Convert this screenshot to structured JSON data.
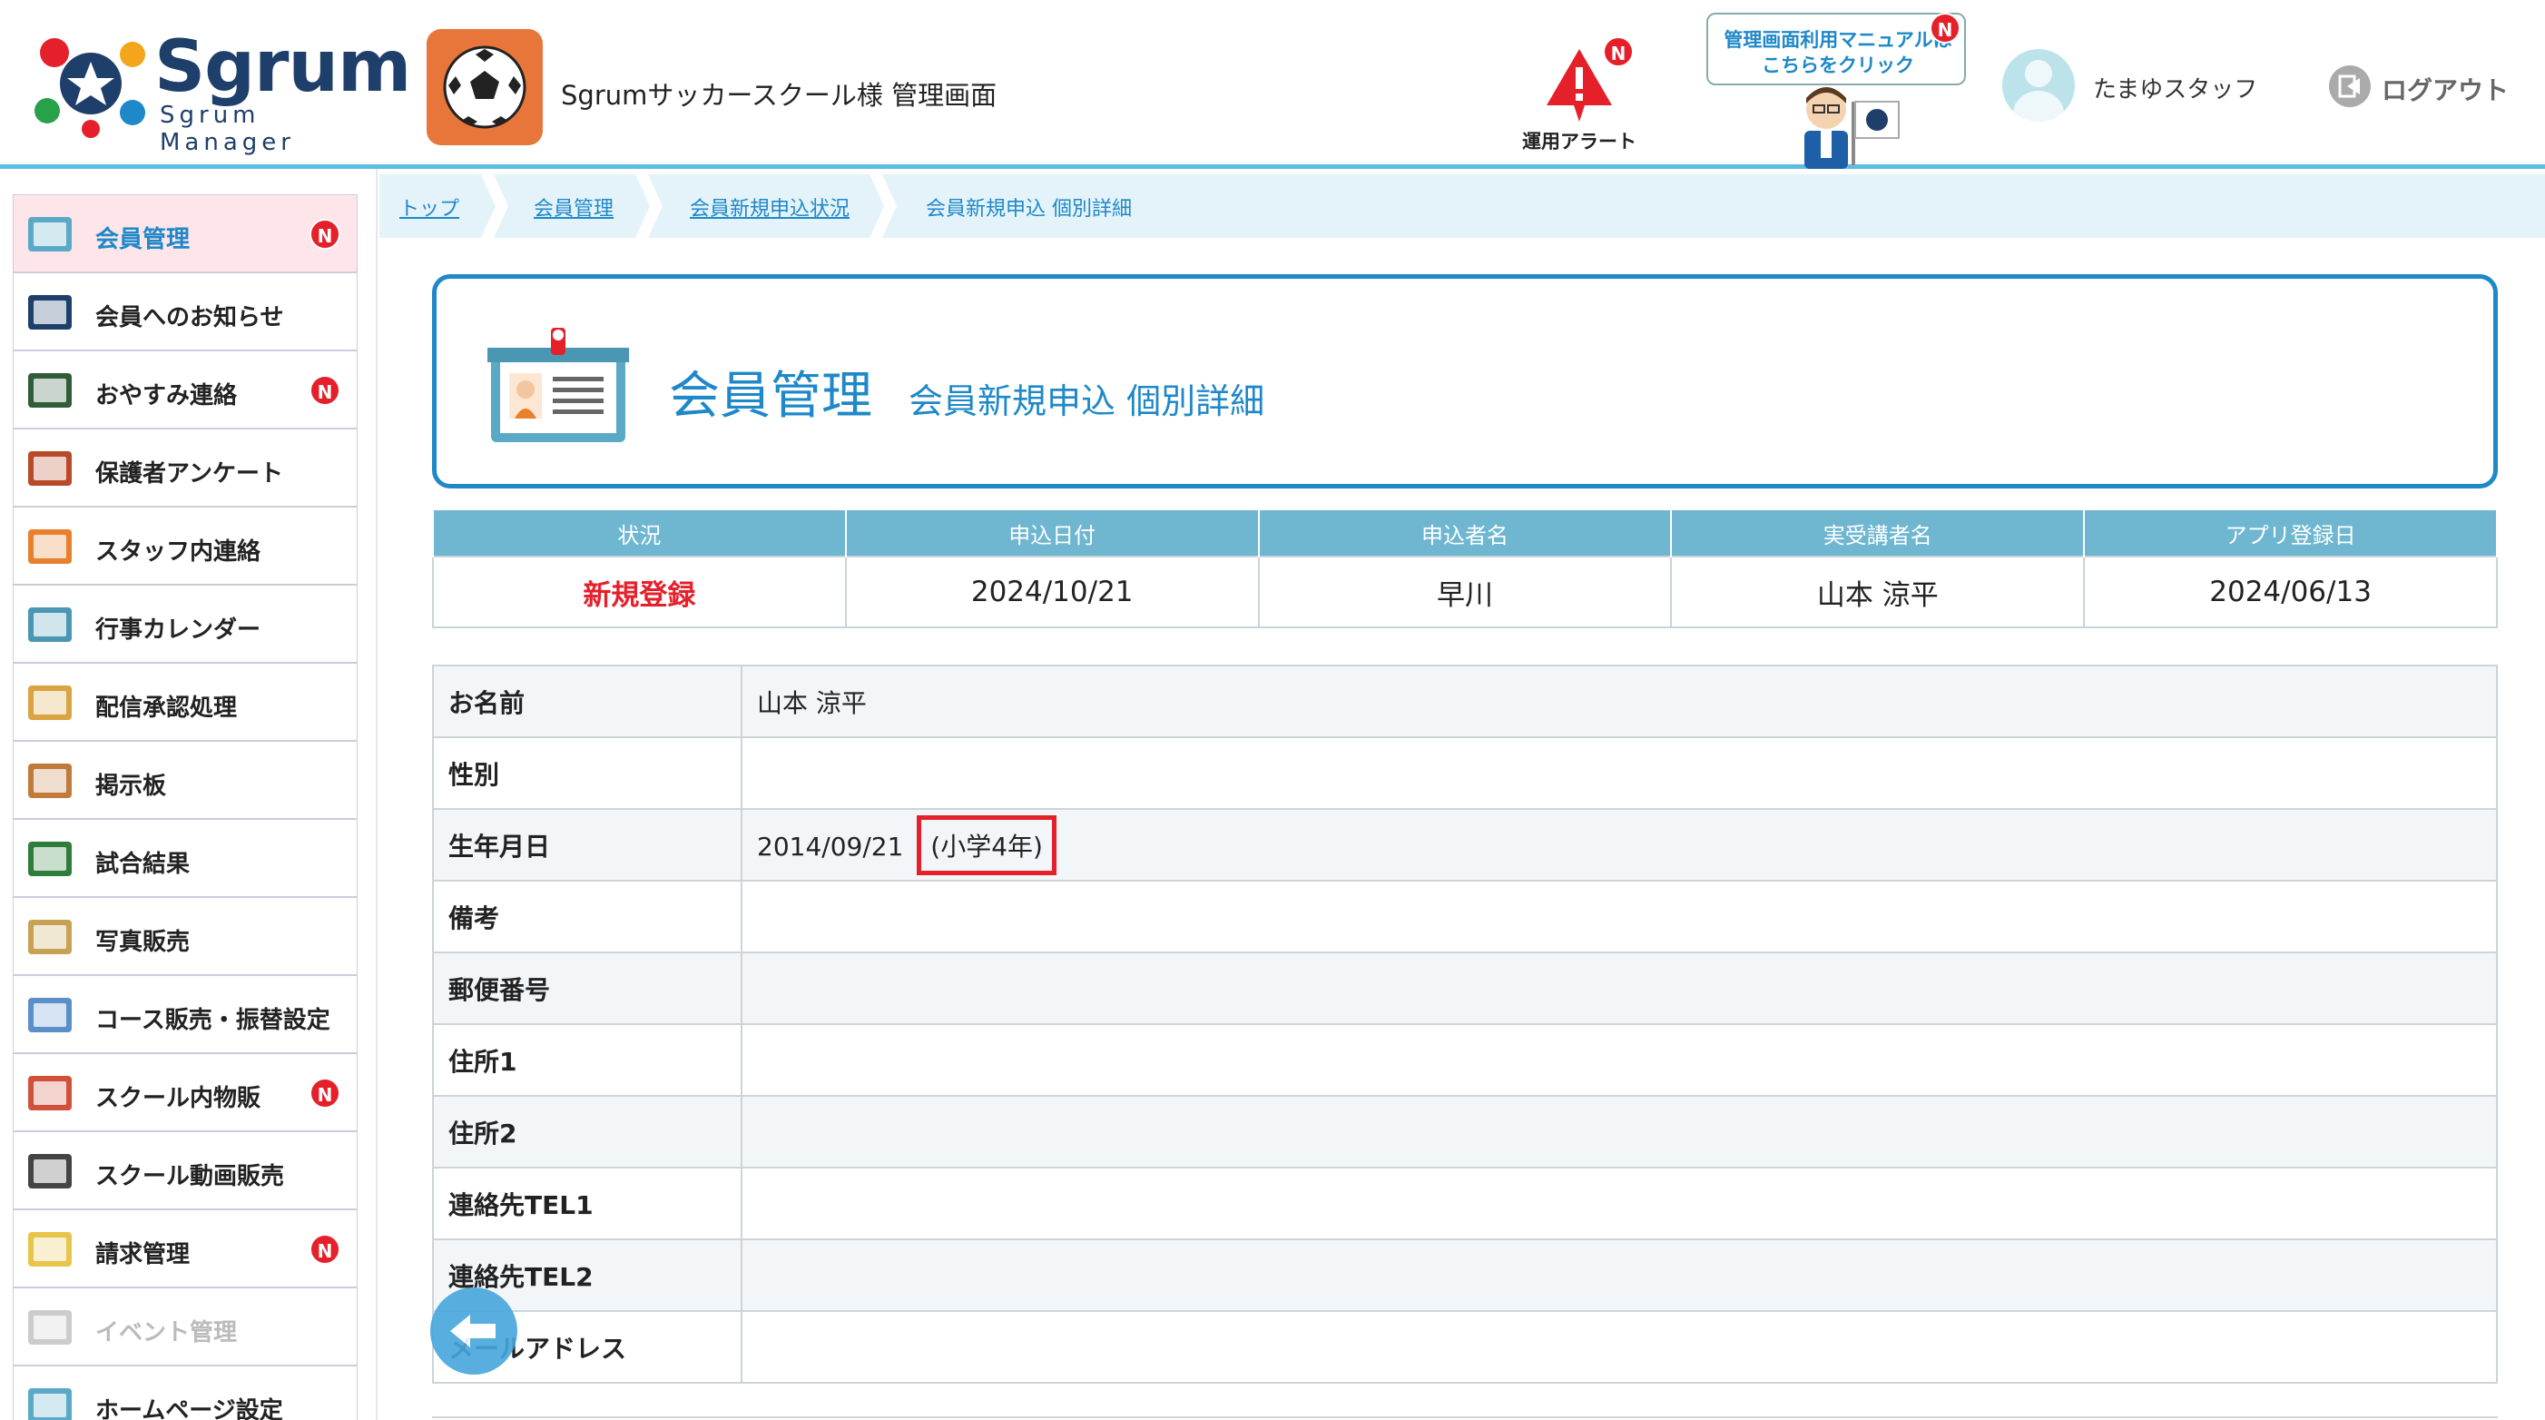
{
  "header": {
    "logo_title": "Sgrum",
    "logo_sub": "Sgrum Manager",
    "org_title": "Sgrumサッカースクール様 管理画面",
    "alert_label": "運用アラート",
    "alert_badge": "N",
    "manual_line1": "管理画面利用マニュアルは",
    "manual_line2": "こちらをクリック",
    "manual_badge": "N",
    "user_name": "たまゆスタッフ",
    "logout_label": "ログアウト"
  },
  "sidebar": {
    "items": [
      {
        "label": "会員管理",
        "badge": "N",
        "icon": "member-card-icon"
      },
      {
        "label": "会員へのお知らせ",
        "badge": "",
        "icon": "team-logo-icon"
      },
      {
        "label": "おやすみ連絡",
        "badge": "N",
        "icon": "notebook-icon"
      },
      {
        "label": "保護者アンケート",
        "badge": "",
        "icon": "clipboard-icon"
      },
      {
        "label": "スタッフ内連絡",
        "badge": "",
        "icon": "staff-icon"
      },
      {
        "label": "行事カレンダー",
        "badge": "",
        "icon": "calendar-icon"
      },
      {
        "label": "配信承認処理",
        "badge": "",
        "icon": "stamp-icon"
      },
      {
        "label": "掲示板",
        "badge": "",
        "icon": "board-icon"
      },
      {
        "label": "試合結果",
        "badge": "",
        "icon": "scoreboard-icon"
      },
      {
        "label": "写真販売",
        "badge": "",
        "icon": "photo-icon"
      },
      {
        "label": "コース販売・振替設定",
        "badge": "",
        "icon": "route-icon"
      },
      {
        "label": "スクール内物販",
        "badge": "N",
        "icon": "cart-icon"
      },
      {
        "label": "スクール動画販売",
        "badge": "",
        "icon": "video-icon"
      },
      {
        "label": "請求管理",
        "badge": "N",
        "icon": "invoice-icon"
      },
      {
        "label": "イベント管理",
        "badge": "",
        "icon": "event-icon"
      },
      {
        "label": "ホームページ設定",
        "badge": "",
        "icon": "homepage-icon"
      }
    ]
  },
  "breadcrumb": [
    "トップ",
    "会員管理",
    "会員新規申込状況",
    "会員新規申込 個別詳細"
  ],
  "page": {
    "title": "会員管理",
    "subtitle": "会員新規申込 個別詳細"
  },
  "summary": {
    "headers": [
      "状況",
      "申込日付",
      "申込者名",
      "実受講者名",
      "アプリ登録日"
    ],
    "values": [
      "新規登録",
      "2024/10/21",
      "早川",
      "山本 涼平",
      "2024/06/13"
    ]
  },
  "detail": {
    "rows": [
      {
        "label": "お名前",
        "value": "山本 涼平"
      },
      {
        "label": "性別",
        "value": ""
      },
      {
        "label": "生年月日",
        "value": "2014/09/21",
        "note": "(小学4年)"
      },
      {
        "label": "備考",
        "value": ""
      },
      {
        "label": "郵便番号",
        "value": ""
      },
      {
        "label": "住所1",
        "value": ""
      },
      {
        "label": "住所2",
        "value": ""
      },
      {
        "label": "連絡先TEL1",
        "value": ""
      },
      {
        "label": "連絡先TEL2",
        "value": ""
      },
      {
        "label": "メールアドレス",
        "value": ""
      }
    ]
  },
  "colors": {
    "accent": "#1e88c8",
    "header_rule": "#5bbde3",
    "badge": "#e5202b",
    "table_header": "#6fb7d0",
    "active_nav": "#fde5ea"
  }
}
